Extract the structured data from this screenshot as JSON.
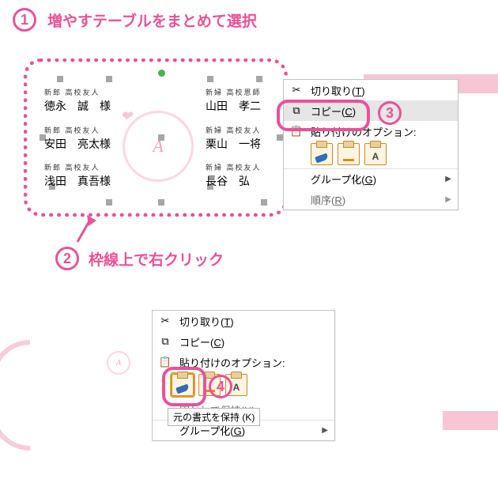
{
  "step1": {
    "num": "1",
    "text": "増やすテーブルをまとめて選択"
  },
  "step2": {
    "num": "2",
    "text": "枠線上で右クリック"
  },
  "step3": {
    "num": "3"
  },
  "step4": {
    "num": "4"
  },
  "names": {
    "n1": {
      "top": "新郎 高校友人",
      "name": "徳永　誠　様"
    },
    "n2": {
      "top": "新郎 高校友人",
      "name": "安田　亮太様"
    },
    "n3": {
      "top": "新郎 高校友人",
      "name": "浅田　真吾様"
    },
    "n4": {
      "top": "新婦 高校恩師",
      "name": "山田　孝二"
    },
    "n5": {
      "top": "新婦 高校友人",
      "name": "栗山　一将"
    },
    "n6": {
      "top": "新婦 高校友人",
      "name": "長谷　弘"
    }
  },
  "menu": {
    "cut": "切り取り(",
    "cut_u": "T",
    "cut2": ")",
    "copy": "コピー(",
    "copy_u": "C",
    "copy2": ")",
    "paste_opts": "貼り付けのオプション:",
    "group": "グループ化(",
    "group_u": "G",
    "group2": ")",
    "order": "順序(",
    "order_u": "R",
    "order2": ")",
    "keep_tooltip": "元の書式を保持 (K)",
    "keep_merge": "図として保持(",
    "keep_merge_u": "U",
    "keep_merge2": ")"
  },
  "watermark": "A"
}
